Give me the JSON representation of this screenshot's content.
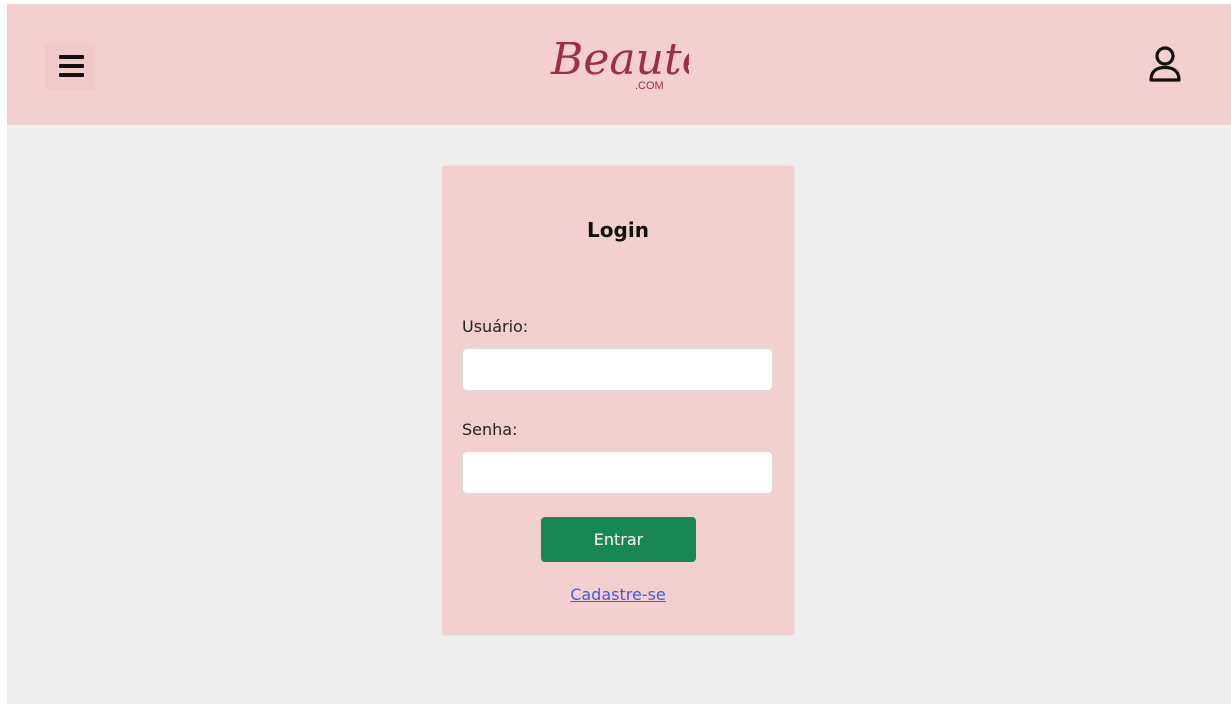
{
  "header": {
    "logo_text": "Beauté",
    "logo_suffix": ".COM",
    "menu_icon": "hamburger-menu-icon",
    "user_icon": "user-icon"
  },
  "login": {
    "title": "Login",
    "username_label": "Usuário:",
    "username_value": "",
    "password_label": "Senha:",
    "password_value": "",
    "submit_label": "Entrar",
    "signup_link": "Cadastre-se"
  },
  "colors": {
    "header_bg": "#f4cfcf",
    "page_bg": "#eeeeee",
    "card_bg": "#f4cfcf",
    "button_green": "#198754",
    "link_blue": "#3a5bf0",
    "logo_color": "#9b2d4d"
  }
}
